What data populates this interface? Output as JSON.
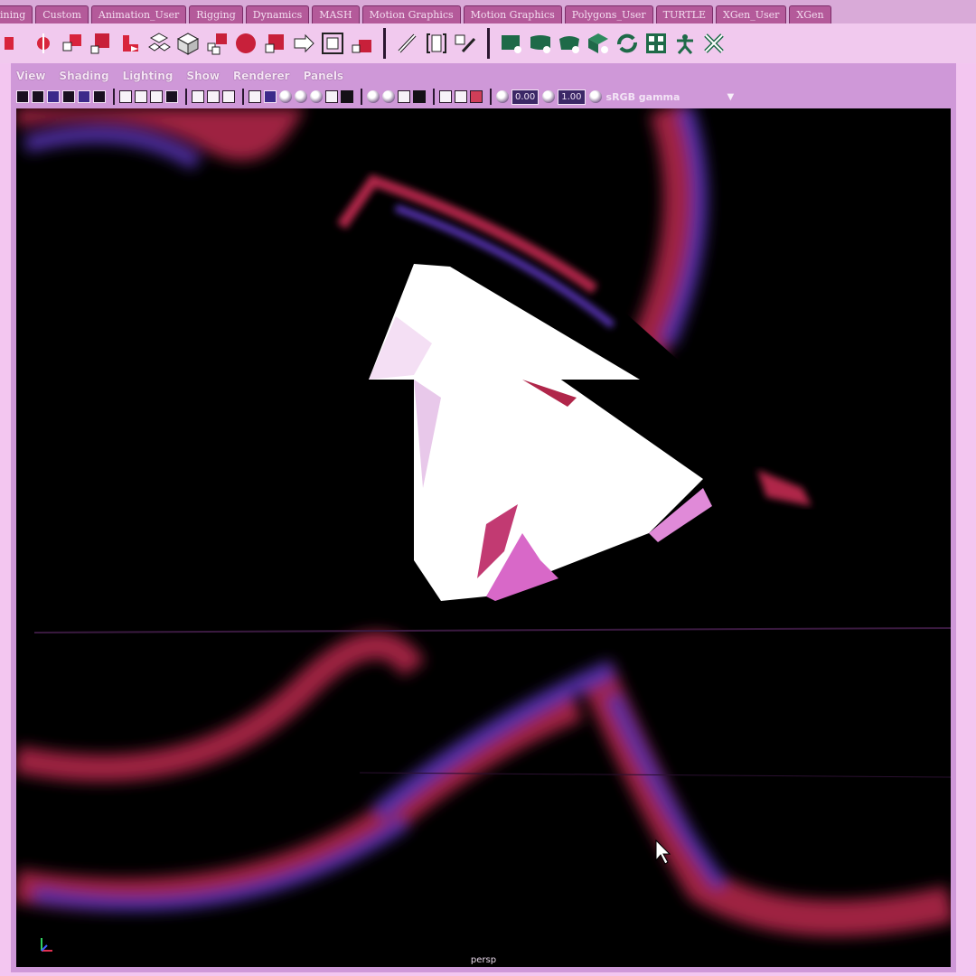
{
  "shelf": {
    "tabs": [
      "ining",
      "Custom",
      "Animation_User",
      "Rigging",
      "Dynamics",
      "MASH",
      "Motion Graphics",
      "Motion Graphics",
      "Polygons_User",
      "TURTLE",
      "XGen_User",
      "XGen"
    ]
  },
  "shelf_icons": [
    "cube-icon",
    "move-pivot-icon",
    "cube-stack-icon",
    "red-cube-icon",
    "bend-icon",
    "cube-cluster-icon",
    "wireframe-cube-icon",
    "cube-group-icon",
    "sphere-icon",
    "corner-cube-icon",
    "arrow-icon",
    "box-frame-icon",
    "small-cube-icon",
    "pencil-icon",
    "bracket-icon",
    "edit-curve-icon",
    "poly-shape-icon",
    "poly-shape-2-icon",
    "poly-shape-3-icon",
    "poly-shape-4-icon",
    "cycle-icon",
    "grid-dice-icon",
    "figure-icon",
    "cross-out-icon"
  ],
  "panel": {
    "menu": [
      "View",
      "Shading",
      "Lighting",
      "Show",
      "Renderer",
      "Panels"
    ],
    "exposure_value": "0.00",
    "gamma_value": "1.00",
    "color_space": "sRGB gamma",
    "camera": "persp"
  },
  "colors": {
    "tab": "#b45a9a",
    "panel": "#cf98d8",
    "viewport": "#000000",
    "object": "#ffffff",
    "glow_red": "#b0264a",
    "glow_blue": "#5a34b8"
  }
}
